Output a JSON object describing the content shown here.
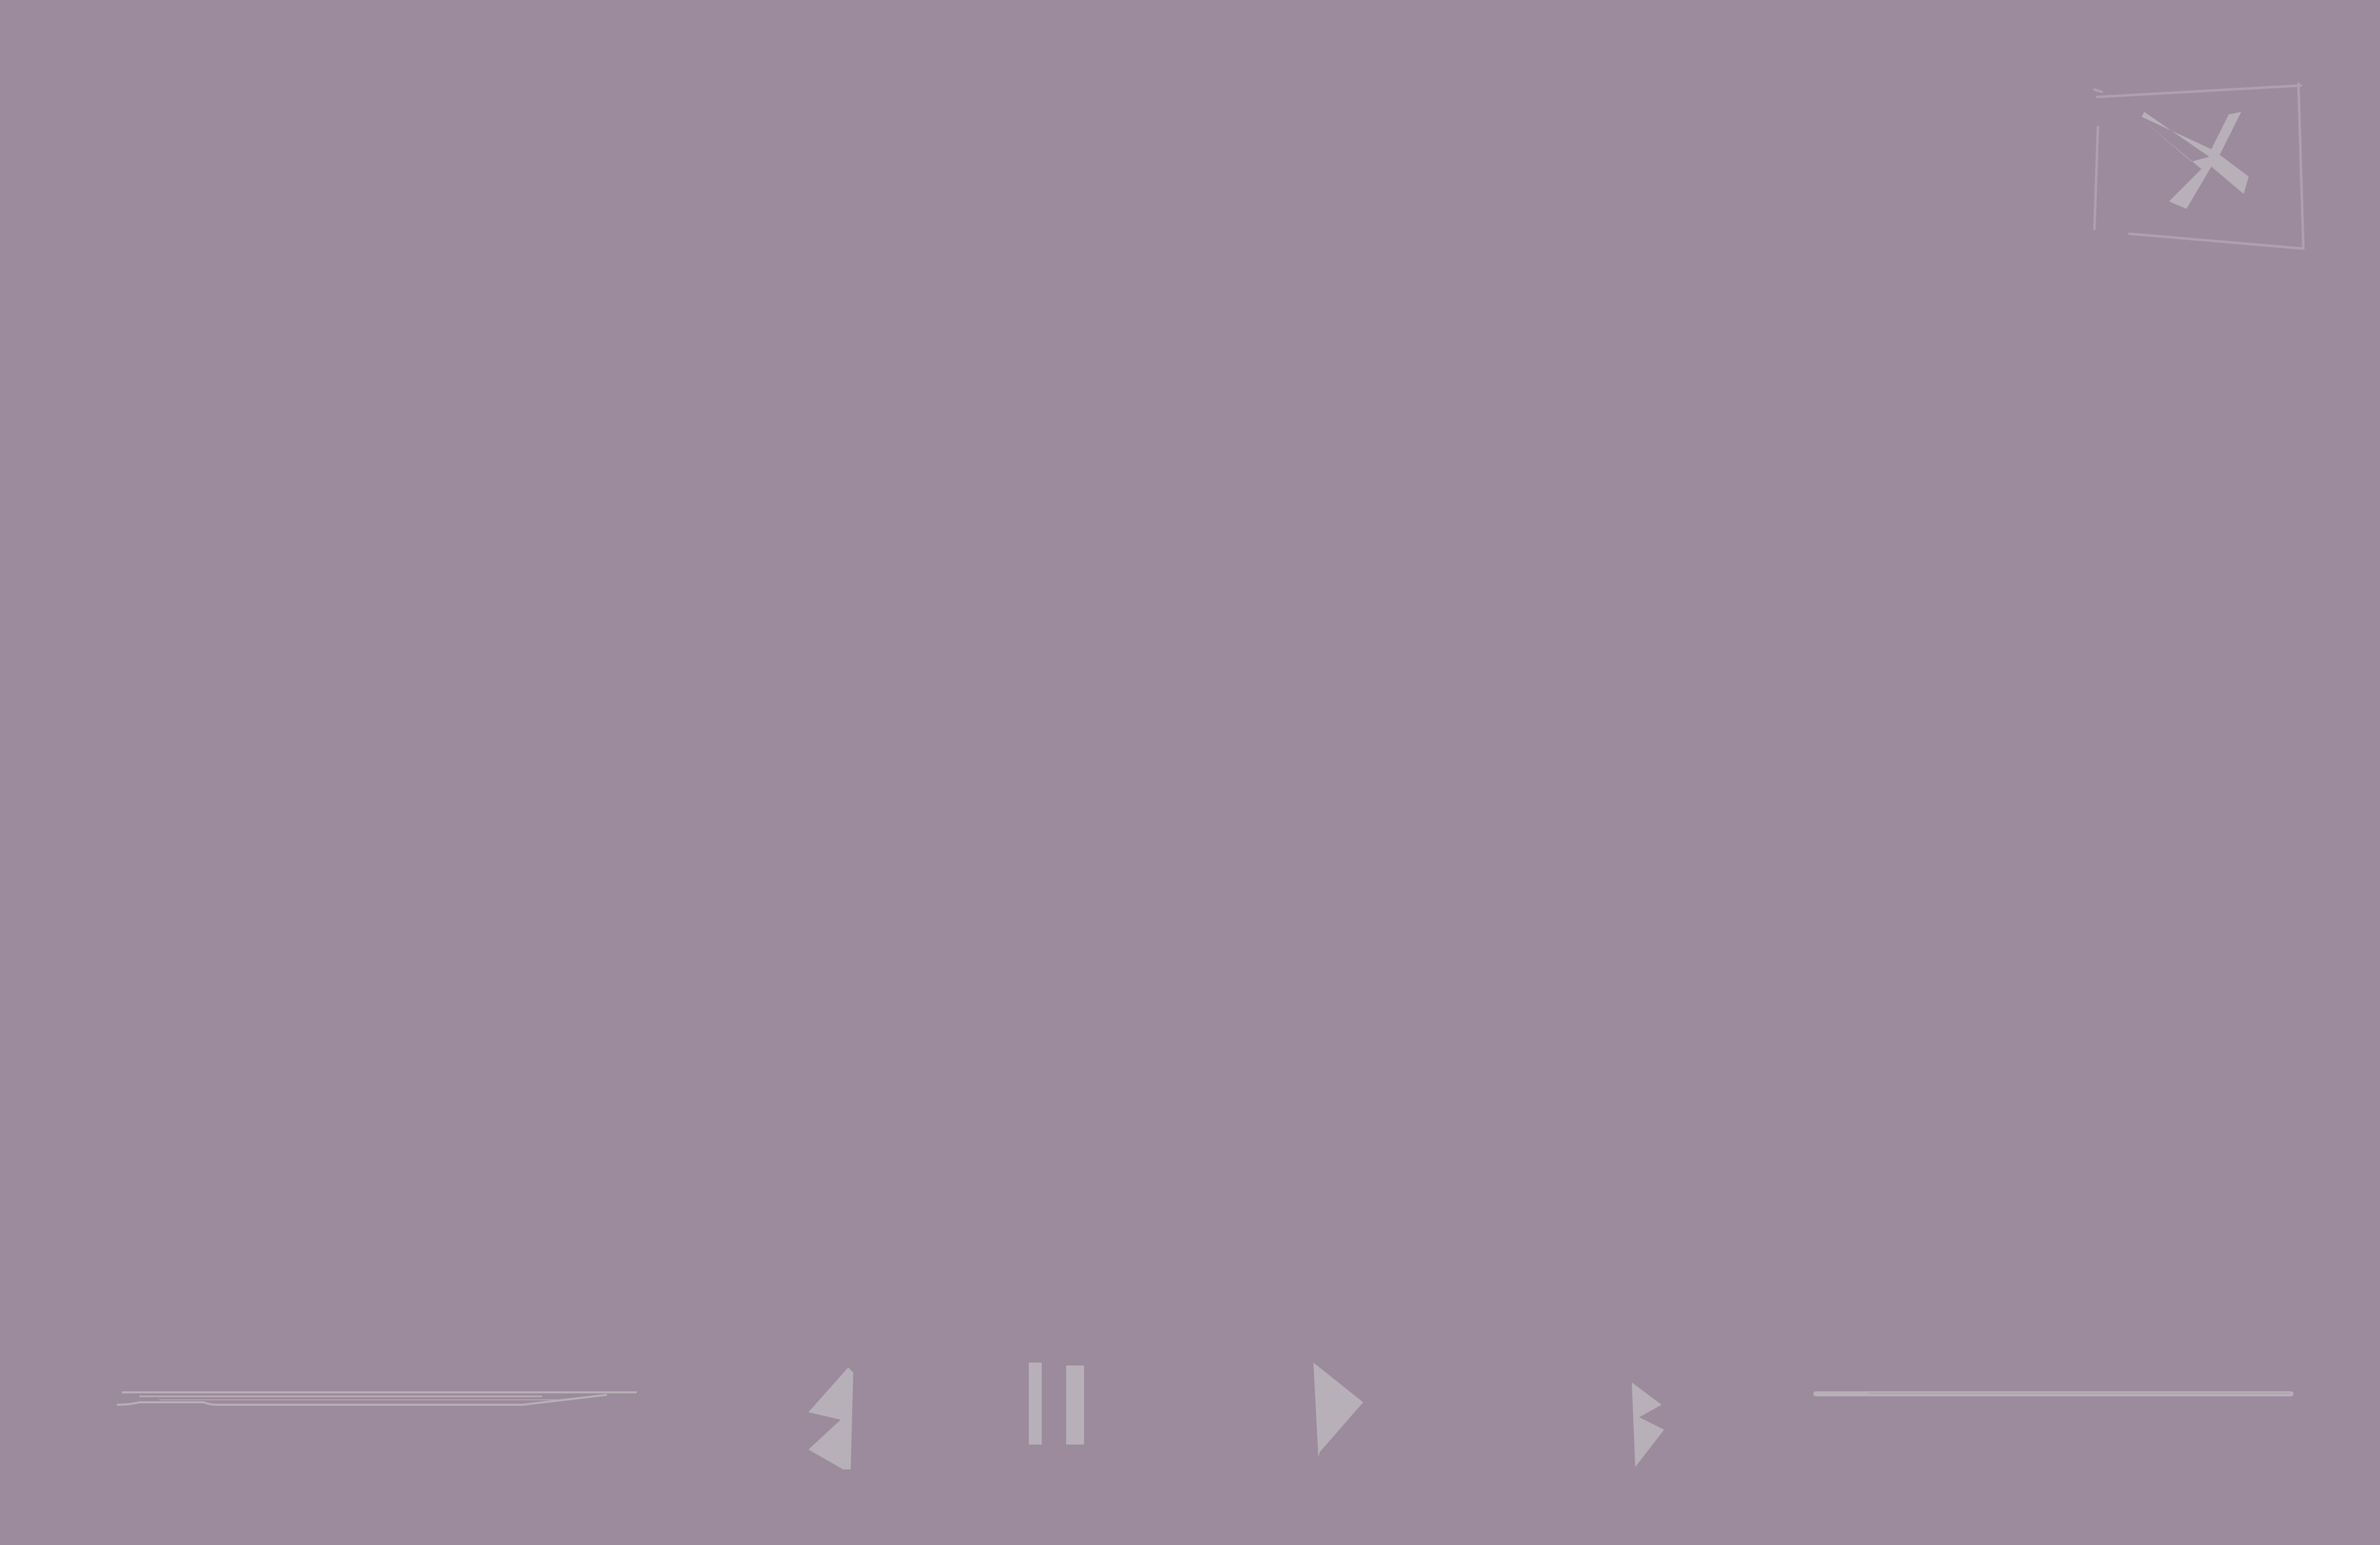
{
  "colors": {
    "background": "#9c8b9c",
    "control": "#b8b0b8",
    "outline": "#aea0ae"
  },
  "controls": {
    "close": {
      "icon": "close-icon"
    },
    "left_bar": {
      "icon": "progress-bar",
      "fill_fraction": 0.85
    },
    "previous": {
      "icon": "previous-icon"
    },
    "pause": {
      "icon": "pause-icon"
    },
    "play": {
      "icon": "play-icon"
    },
    "next": {
      "icon": "next-icon"
    },
    "right_bar": {
      "icon": "volume-bar",
      "fill_fraction": 1.0
    }
  }
}
